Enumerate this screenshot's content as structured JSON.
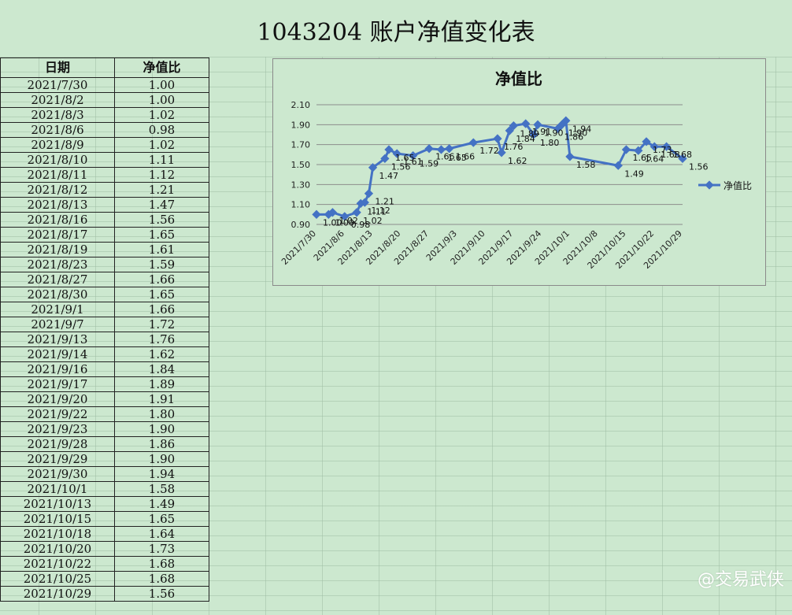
{
  "page": {
    "title": "1043204 账户净值变化表",
    "watermark": "@交易武侠"
  },
  "table": {
    "headers": [
      "日期",
      "净值比"
    ],
    "rows": [
      [
        "2021/7/30",
        "1.00"
      ],
      [
        "2021/8/2",
        "1.00"
      ],
      [
        "2021/8/3",
        "1.02"
      ],
      [
        "2021/8/6",
        "0.98"
      ],
      [
        "2021/8/9",
        "1.02"
      ],
      [
        "2021/8/10",
        "1.11"
      ],
      [
        "2021/8/11",
        "1.12"
      ],
      [
        "2021/8/12",
        "1.21"
      ],
      [
        "2021/8/13",
        "1.47"
      ],
      [
        "2021/8/16",
        "1.56"
      ],
      [
        "2021/8/17",
        "1.65"
      ],
      [
        "2021/8/19",
        "1.61"
      ],
      [
        "2021/8/23",
        "1.59"
      ],
      [
        "2021/8/27",
        "1.66"
      ],
      [
        "2021/8/30",
        "1.65"
      ],
      [
        "2021/9/1",
        "1.66"
      ],
      [
        "2021/9/7",
        "1.72"
      ],
      [
        "2021/9/13",
        "1.76"
      ],
      [
        "2021/9/14",
        "1.62"
      ],
      [
        "2021/9/16",
        "1.84"
      ],
      [
        "2021/9/17",
        "1.89"
      ],
      [
        "2021/9/20",
        "1.91"
      ],
      [
        "2021/9/22",
        "1.80"
      ],
      [
        "2021/9/23",
        "1.90"
      ],
      [
        "2021/9/28",
        "1.86"
      ],
      [
        "2021/9/29",
        "1.90"
      ],
      [
        "2021/9/30",
        "1.94"
      ],
      [
        "2021/10/1",
        "1.58"
      ],
      [
        "2021/10/13",
        "1.49"
      ],
      [
        "2021/10/15",
        "1.65"
      ],
      [
        "2021/10/18",
        "1.64"
      ],
      [
        "2021/10/20",
        "1.73"
      ],
      [
        "2021/10/22",
        "1.68"
      ],
      [
        "2021/10/25",
        "1.68"
      ],
      [
        "2021/10/29",
        "1.56"
      ]
    ]
  },
  "chart_data": {
    "type": "line",
    "title": "净值比",
    "xlabel": "",
    "ylabel": "",
    "x_axis": "date",
    "xlim": [
      "2021-07-30",
      "2021-10-29"
    ],
    "x_tick_labels": [
      "2021/7/30",
      "2021/8/6",
      "2021/8/13",
      "2021/8/20",
      "2021/8/27",
      "2021/9/3",
      "2021/9/10",
      "2021/9/17",
      "2021/9/24",
      "2021/10/1",
      "2021/10/8",
      "2021/10/15",
      "2021/10/22",
      "2021/10/29"
    ],
    "ylim": [
      0.9,
      2.1
    ],
    "y_ticks": [
      "0.90",
      "1.10",
      "1.30",
      "1.50",
      "1.70",
      "1.90",
      "2.10"
    ],
    "grid": "horizontal",
    "legend": "right",
    "series": [
      {
        "name": "净值比",
        "color": "#4472c4",
        "x": [
          "2021-07-30",
          "2021-08-02",
          "2021-08-03",
          "2021-08-06",
          "2021-08-09",
          "2021-08-10",
          "2021-08-11",
          "2021-08-12",
          "2021-08-13",
          "2021-08-16",
          "2021-08-17",
          "2021-08-19",
          "2021-08-23",
          "2021-08-27",
          "2021-08-30",
          "2021-09-01",
          "2021-09-07",
          "2021-09-13",
          "2021-09-14",
          "2021-09-16",
          "2021-09-17",
          "2021-09-20",
          "2021-09-22",
          "2021-09-23",
          "2021-09-28",
          "2021-09-29",
          "2021-09-30",
          "2021-10-01",
          "2021-10-13",
          "2021-10-15",
          "2021-10-18",
          "2021-10-20",
          "2021-10-22",
          "2021-10-25",
          "2021-10-29"
        ],
        "values": [
          1.0,
          1.0,
          1.02,
          0.98,
          1.02,
          1.11,
          1.12,
          1.21,
          1.47,
          1.56,
          1.65,
          1.61,
          1.59,
          1.66,
          1.65,
          1.66,
          1.72,
          1.76,
          1.62,
          1.84,
          1.89,
          1.91,
          1.8,
          1.9,
          1.86,
          1.9,
          1.94,
          1.58,
          1.49,
          1.65,
          1.64,
          1.73,
          1.68,
          1.68,
          1.56
        ]
      }
    ]
  }
}
